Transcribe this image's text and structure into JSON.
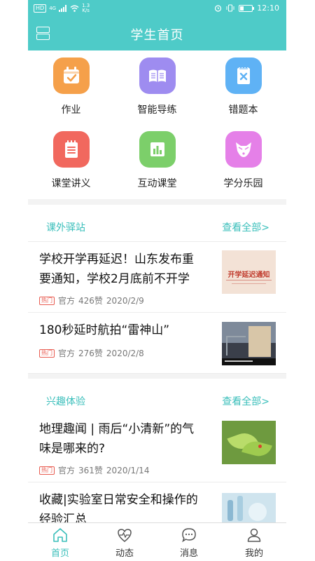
{
  "status_bar": {
    "network": "HD",
    "signal": "4G",
    "speed_top": "1.3",
    "speed_unit": "K/s",
    "time": "12:10"
  },
  "header": {
    "title": "学生首页"
  },
  "features": [
    {
      "label": "作业",
      "icon": "calendar-check-icon",
      "color": "#f5a04a"
    },
    {
      "label": "智能导练",
      "icon": "open-book-icon",
      "color": "#9e8cf0"
    },
    {
      "label": "错题本",
      "icon": "notebook-x-icon",
      "color": "#5fb2f5"
    },
    {
      "label": "课堂讲义",
      "icon": "notepad-icon",
      "color": "#f1685e"
    },
    {
      "label": "互动课堂",
      "icon": "bar-chart-icon",
      "color": "#7ccf6a"
    },
    {
      "label": "学分乐园",
      "icon": "fox-icon",
      "color": "#e580e8"
    }
  ],
  "sections": [
    {
      "title": "课外驿站",
      "more": "查看全部>",
      "articles": [
        {
          "title": "学校开学再延迟！山东发布重要通知，学校2月底前不开学",
          "tag": "热门",
          "source": "官方",
          "likes": "426赞",
          "date": "2020/2/9",
          "thumb_text": "开学延迟通知"
        },
        {
          "title": "180秒延时航拍“雷神山”",
          "tag": "热门",
          "source": "官方",
          "likes": "276赞",
          "date": "2020/2/8"
        }
      ]
    },
    {
      "title": "兴趣体验",
      "more": "查看全部>",
      "articles": [
        {
          "title": "地理趣闻 | 雨后“小清新”的气味是哪来的?",
          "tag": "热门",
          "source": "官方",
          "likes": "361赞",
          "date": "2020/1/14"
        },
        {
          "title": "收藏|实验室日常安全和操作的经验汇总"
        }
      ]
    }
  ],
  "tabs": [
    {
      "label": "首页",
      "icon": "home-icon",
      "active": true
    },
    {
      "label": "动态",
      "icon": "heartbeat-icon"
    },
    {
      "label": "消息",
      "icon": "chat-bubble-icon"
    },
    {
      "label": "我的",
      "icon": "user-icon"
    }
  ],
  "colors": {
    "accent": "#4ecbc8",
    "accent_text": "#3bbfbb",
    "hot_tag": "#e85a4f"
  }
}
